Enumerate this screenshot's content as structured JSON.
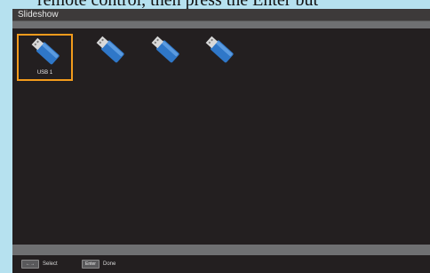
{
  "document_text": "remote control, then press the Enter but",
  "window": {
    "title": "Slideshow"
  },
  "devices": [
    {
      "label": "USB 1",
      "icon": "usb-drive-icon",
      "selected": true
    },
    {
      "label": "",
      "icon": "usb-drive-icon",
      "selected": false
    },
    {
      "label": "",
      "icon": "usb-drive-icon",
      "selected": false
    },
    {
      "label": "",
      "icon": "usb-drive-icon",
      "selected": false
    }
  ],
  "hints": {
    "select": {
      "key": "←→",
      "label": "Select"
    },
    "done": {
      "key": "Enter",
      "label": "Done"
    }
  },
  "colors": {
    "selection": "#f29b1c",
    "background": "#231f20",
    "usb_blue": "#2f77c8",
    "page_background": "#b6e1ef"
  }
}
